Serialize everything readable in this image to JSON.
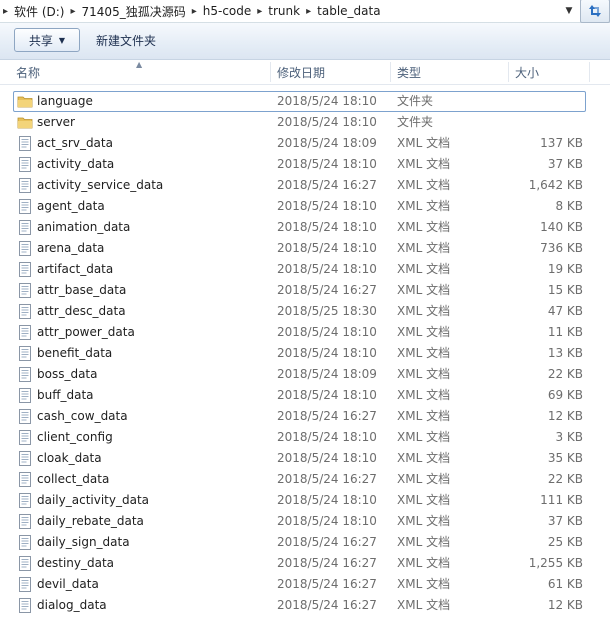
{
  "address": {
    "crumbs": [
      "软件 (D:)",
      "71405_独孤决源码",
      "h5-code",
      "trunk",
      "table_data"
    ]
  },
  "toolbar": {
    "share_label": "共享",
    "new_folder_label": "新建文件夹"
  },
  "columns": {
    "name": "名称",
    "date": "修改日期",
    "type": "类型",
    "size": "大小"
  },
  "files": [
    {
      "name": "language",
      "date": "2018/5/24 18:10",
      "type": "文件夹",
      "size": "",
      "kind": "folder"
    },
    {
      "name": "server",
      "date": "2018/5/24 18:10",
      "type": "文件夹",
      "size": "",
      "kind": "folder"
    },
    {
      "name": "act_srv_data",
      "date": "2018/5/24 18:09",
      "type": "XML 文档",
      "size": "137 KB",
      "kind": "xml"
    },
    {
      "name": "activity_data",
      "date": "2018/5/24 18:10",
      "type": "XML 文档",
      "size": "37 KB",
      "kind": "xml"
    },
    {
      "name": "activity_service_data",
      "date": "2018/5/24 16:27",
      "type": "XML 文档",
      "size": "1,642 KB",
      "kind": "xml"
    },
    {
      "name": "agent_data",
      "date": "2018/5/24 18:10",
      "type": "XML 文档",
      "size": "8 KB",
      "kind": "xml"
    },
    {
      "name": "animation_data",
      "date": "2018/5/24 18:10",
      "type": "XML 文档",
      "size": "140 KB",
      "kind": "xml"
    },
    {
      "name": "arena_data",
      "date": "2018/5/24 18:10",
      "type": "XML 文档",
      "size": "736 KB",
      "kind": "xml"
    },
    {
      "name": "artifact_data",
      "date": "2018/5/24 18:10",
      "type": "XML 文档",
      "size": "19 KB",
      "kind": "xml"
    },
    {
      "name": "attr_base_data",
      "date": "2018/5/24 16:27",
      "type": "XML 文档",
      "size": "15 KB",
      "kind": "xml"
    },
    {
      "name": "attr_desc_data",
      "date": "2018/5/25 18:30",
      "type": "XML 文档",
      "size": "47 KB",
      "kind": "xml"
    },
    {
      "name": "attr_power_data",
      "date": "2018/5/24 18:10",
      "type": "XML 文档",
      "size": "11 KB",
      "kind": "xml"
    },
    {
      "name": "benefit_data",
      "date": "2018/5/24 18:10",
      "type": "XML 文档",
      "size": "13 KB",
      "kind": "xml"
    },
    {
      "name": "boss_data",
      "date": "2018/5/24 18:09",
      "type": "XML 文档",
      "size": "22 KB",
      "kind": "xml"
    },
    {
      "name": "buff_data",
      "date": "2018/5/24 18:10",
      "type": "XML 文档",
      "size": "69 KB",
      "kind": "xml"
    },
    {
      "name": "cash_cow_data",
      "date": "2018/5/24 16:27",
      "type": "XML 文档",
      "size": "12 KB",
      "kind": "xml"
    },
    {
      "name": "client_config",
      "date": "2018/5/24 18:10",
      "type": "XML 文档",
      "size": "3 KB",
      "kind": "xml"
    },
    {
      "name": "cloak_data",
      "date": "2018/5/24 18:10",
      "type": "XML 文档",
      "size": "35 KB",
      "kind": "xml"
    },
    {
      "name": "collect_data",
      "date": "2018/5/24 16:27",
      "type": "XML 文档",
      "size": "22 KB",
      "kind": "xml"
    },
    {
      "name": "daily_activity_data",
      "date": "2018/5/24 18:10",
      "type": "XML 文档",
      "size": "111 KB",
      "kind": "xml"
    },
    {
      "name": "daily_rebate_data",
      "date": "2018/5/24 18:10",
      "type": "XML 文档",
      "size": "37 KB",
      "kind": "xml"
    },
    {
      "name": "daily_sign_data",
      "date": "2018/5/24 16:27",
      "type": "XML 文档",
      "size": "25 KB",
      "kind": "xml"
    },
    {
      "name": "destiny_data",
      "date": "2018/5/24 16:27",
      "type": "XML 文档",
      "size": "1,255 KB",
      "kind": "xml"
    },
    {
      "name": "devil_data",
      "date": "2018/5/24 16:27",
      "type": "XML 文档",
      "size": "61 KB",
      "kind": "xml"
    },
    {
      "name": "dialog_data",
      "date": "2018/5/24 16:27",
      "type": "XML 文档",
      "size": "12 KB",
      "kind": "xml"
    }
  ],
  "icons": {
    "folder": "folder-icon",
    "xml": "xml-file-icon",
    "refresh": "refresh-icon",
    "dropdown": "chevron-down-icon"
  },
  "colors": {
    "folder": "#e8c15a",
    "accent": "#7da2ce"
  }
}
